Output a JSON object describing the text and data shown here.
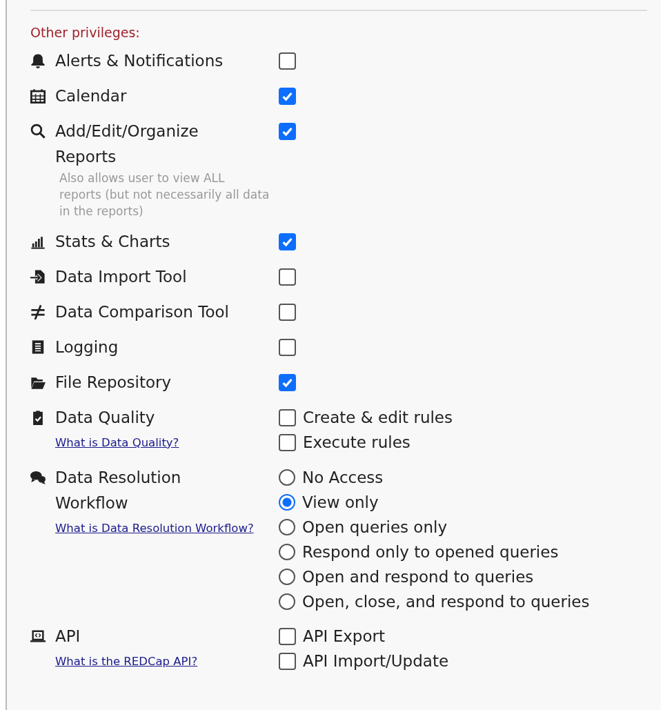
{
  "section_title": "Other privileges:",
  "privileges": [
    {
      "label": "Alerts & Notifications",
      "kind": "checkbox",
      "checked": false
    },
    {
      "label": "Calendar",
      "kind": "checkbox",
      "checked": true
    },
    {
      "label": "Add/Edit/Organize Reports",
      "note": "Also allows user to view ALL reports (but not necessarily all data in the reports)",
      "kind": "checkbox",
      "checked": true
    },
    {
      "label": "Stats & Charts",
      "kind": "checkbox",
      "checked": true
    },
    {
      "label": "Data Import Tool",
      "kind": "checkbox",
      "checked": false
    },
    {
      "label": "Data Comparison Tool",
      "kind": "checkbox",
      "checked": false
    },
    {
      "label": "Logging",
      "kind": "checkbox",
      "checked": false
    },
    {
      "label": "File Repository",
      "kind": "checkbox",
      "checked": true
    },
    {
      "label": "Data Quality",
      "link": "What is Data Quality?",
      "kind": "checkboxes",
      "options": [
        {
          "label": "Create & edit rules",
          "checked": false
        },
        {
          "label": "Execute rules",
          "checked": false
        }
      ]
    },
    {
      "label": "Data Resolution Workflow",
      "link": "What is Data Resolution Workflow?",
      "kind": "radios",
      "options": [
        {
          "label": "No Access",
          "selected": false
        },
        {
          "label": "View only",
          "selected": true
        },
        {
          "label": "Open queries only",
          "selected": false
        },
        {
          "label": "Respond only to opened queries",
          "selected": false
        },
        {
          "label": "Open and respond to queries",
          "selected": false
        },
        {
          "label": "Open, close, and respond to queries",
          "selected": false
        }
      ]
    },
    {
      "label": "API",
      "link": "What is the REDCap API?",
      "kind": "checkboxes",
      "options": [
        {
          "label": "API Export",
          "checked": false
        },
        {
          "label": "API Import/Update",
          "checked": false
        }
      ]
    }
  ]
}
